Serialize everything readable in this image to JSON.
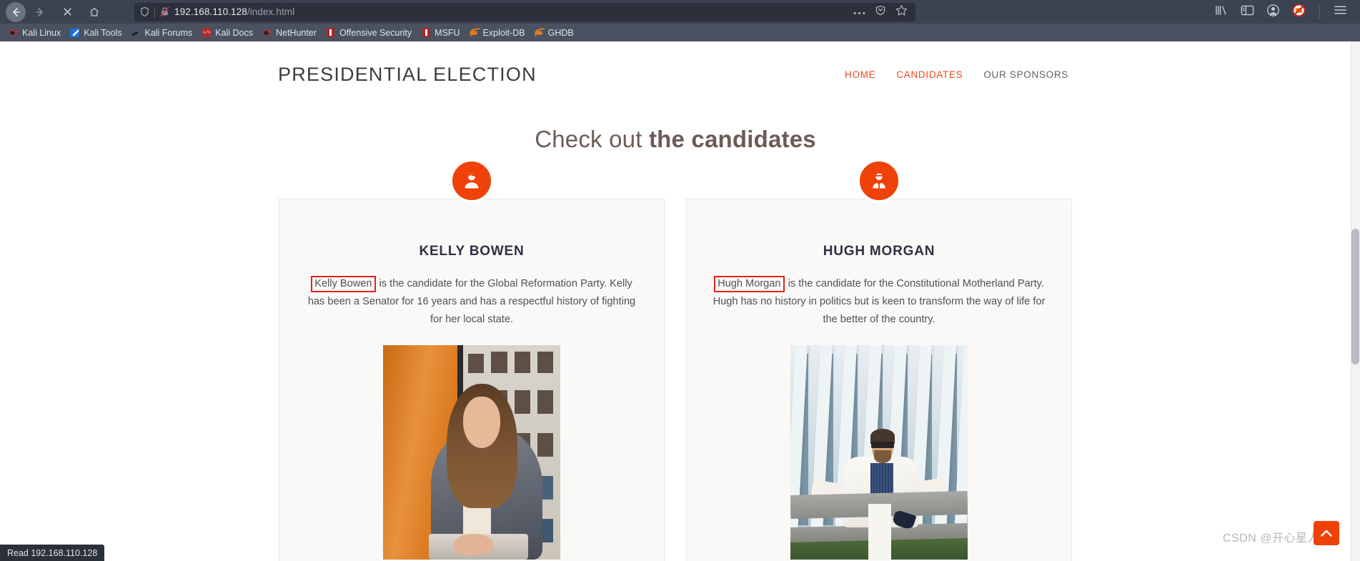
{
  "browser": {
    "toolbar": {
      "back_label": "Back",
      "forward_label": "Forward",
      "stop_label": "Stop",
      "home_label": "Home",
      "shield_label": "tracking-protection",
      "insecure_label": "connection-not-secure",
      "url_host": "192.168.110.128",
      "url_path": "/index.html",
      "url_full": "192.168.110.128/index.html",
      "page_actions_label": "More page actions",
      "reader_label": "Toggle reader view",
      "bookmark_label": "Bookmark this page",
      "library_label": "Library",
      "sidebar_label": "Sidebar",
      "account_label": "Account",
      "noscript_label": "NoScript",
      "menu_label": "Open application menu"
    },
    "bookmarks": [
      {
        "label": "Kali Linux",
        "icon": "kali-dragon-icon"
      },
      {
        "label": "Kali Tools",
        "icon": "kali-tools-icon"
      },
      {
        "label": "Kali Forums",
        "icon": "kali-forums-icon"
      },
      {
        "label": "Kali Docs",
        "icon": "kali-docs-icon"
      },
      {
        "label": "NetHunter",
        "icon": "nethunter-icon"
      },
      {
        "label": "Offensive Security",
        "icon": "offensive-security-icon"
      },
      {
        "label": "MSFU",
        "icon": "msfu-icon"
      },
      {
        "label": "Exploit-DB",
        "icon": "exploit-db-icon"
      },
      {
        "label": "GHDB",
        "icon": "ghdb-icon"
      }
    ],
    "status_bar": {
      "text": "Read 192.168.110.128"
    }
  },
  "site": {
    "brand": "PRESIDENTIAL ELECTION",
    "nav": [
      {
        "label": "HOME",
        "active": true
      },
      {
        "label": "CANDIDATES",
        "active": true
      },
      {
        "label": "OUR SPONSORS",
        "active": false
      }
    ],
    "section": {
      "title_light": "Check out ",
      "title_bold": "the candidates"
    },
    "candidates": [
      {
        "name": "KELLY BOWEN",
        "highlight": "Kelly Bowen",
        "desc_rest": " is the candidate for the Global Reformation Party. Kelly has been a Senator for 16 years and has a respectful history of fighting for her local state.",
        "badge_icon": "user-female-icon",
        "photo_alt": "woman in grey blazer by office window"
      },
      {
        "name": "HUGH MORGAN",
        "highlight": "Hugh Morgan",
        "desc_rest": " is the candidate for the Constitutional Motherland Party. Hugh has no history in politics but is keen to transform the way of life for the better of the country.",
        "badge_icon": "user-male-icon",
        "photo_alt": "man in white suit sitting on ledge"
      }
    ],
    "to_top_label": "Back to top"
  },
  "overlay": {
    "watermark": "CSDN @开心星人"
  },
  "colors": {
    "accent": "#ee4208",
    "nav_active": "#e8491d",
    "chrome_bg": "#3b4351",
    "bookmarks_bg": "#4a5160",
    "url_bg": "#2b303b",
    "card_bg": "#faf9f7",
    "highlight_border": "#e4221f",
    "heading": "#6d5b55"
  }
}
